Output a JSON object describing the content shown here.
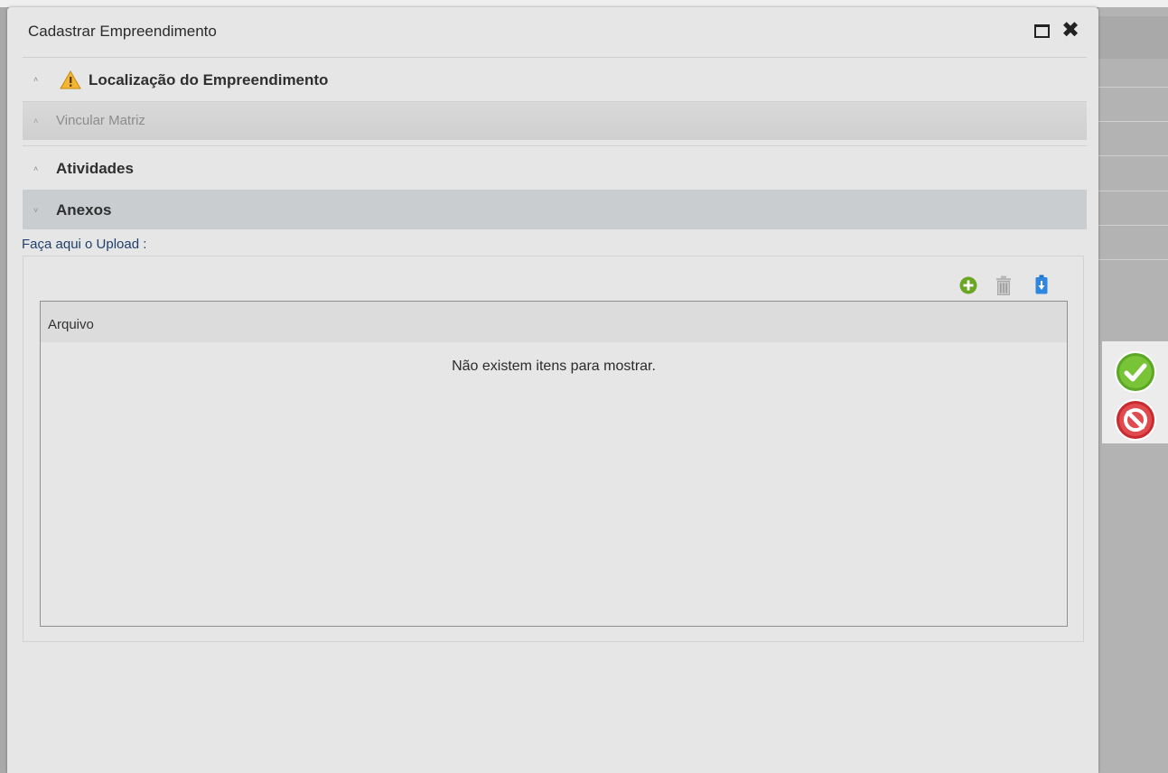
{
  "modal": {
    "title": "Cadastrar Empreendimento"
  },
  "sections": [
    {
      "label": "Localização do Empreendimento",
      "chevron": "˄",
      "icon": "warning-icon"
    },
    {
      "label": "Vincular Matriz",
      "chevron": "˄"
    },
    {
      "label": "Atividades",
      "chevron": "˄"
    },
    {
      "label": "Anexos",
      "chevron": "˅"
    }
  ],
  "upload": {
    "label": "Faça aqui o Upload :",
    "toolbar": {
      "add": "add-circle-icon",
      "delete": "trash-icon",
      "download": "download-icon"
    }
  },
  "grid": {
    "columns": [
      "Arquivo"
    ],
    "empty_message": "Não existem itens para mostrar."
  },
  "colors": {
    "accent_green": "#6aa624",
    "cancel_red": "#d9343a",
    "link_blue": "#20406b"
  }
}
